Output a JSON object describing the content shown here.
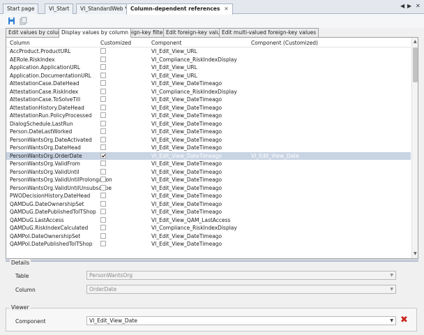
{
  "doc_tabs": [
    {
      "label": "Start page",
      "active": false
    },
    {
      "label": "VI_Start",
      "active": false
    },
    {
      "label": "VI_StandardWeb *",
      "active": false
    },
    {
      "label": "Column-dependent references",
      "active": true
    }
  ],
  "window_controls": {
    "prev": "◀",
    "next": "▶",
    "close": "✕"
  },
  "toolbar": [
    {
      "name": "save-icon",
      "color": "#2f7fd1"
    },
    {
      "name": "copy-icon",
      "color": "#9aa3ad"
    }
  ],
  "inner_tabs": [
    "Edit values by column",
    "Display values by column",
    "Foreign-key filters",
    "Edit foreign-key values",
    "Edit multi-valued foreign-key values"
  ],
  "grid": {
    "headers": [
      "Column",
      "Customized",
      "Component",
      "Component (Customized)"
    ],
    "rows": [
      {
        "column": "AccProduct.ProductURL",
        "checked": false,
        "component": "VI_Edit_View_URL",
        "customized_component": ""
      },
      {
        "column": "AERole.RiskIndex",
        "checked": false,
        "component": "VI_Compliance_RiskIndexDisplay",
        "customized_component": ""
      },
      {
        "column": "Application.ApplicationURL",
        "checked": false,
        "component": "VI_Edit_View_URL",
        "customized_component": ""
      },
      {
        "column": "Application.DocumentationURL",
        "checked": false,
        "component": "VI_Edit_View_URL",
        "customized_component": ""
      },
      {
        "column": "AttestationCase.DateHead",
        "checked": false,
        "component": "VI_Edit_View_DateTimeago",
        "customized_component": ""
      },
      {
        "column": "AttestationCase.RiskIndex",
        "checked": false,
        "component": "VI_Compliance_RiskIndexDisplay",
        "customized_component": ""
      },
      {
        "column": "AttestationCase.ToSolveTill",
        "checked": false,
        "component": "VI_Edit_View_DateTimeago",
        "customized_component": ""
      },
      {
        "column": "AttestationHistory.DateHead",
        "checked": false,
        "component": "VI_Edit_View_DateTimeago",
        "customized_component": ""
      },
      {
        "column": "AttestationRun.PolicyProcessed",
        "checked": false,
        "component": "VI_Edit_View_DateTimeago",
        "customized_component": ""
      },
      {
        "column": "DialogSchedule.LastRun",
        "checked": false,
        "component": "VI_Edit_View_DateTimeago",
        "customized_component": ""
      },
      {
        "column": "Person.DateLastWorked",
        "checked": false,
        "component": "VI_Edit_View_DateTimeago",
        "customized_component": ""
      },
      {
        "column": "PersonWantsOrg.DateActivated",
        "checked": false,
        "component": "VI_Edit_View_DateTimeago",
        "customized_component": ""
      },
      {
        "column": "PersonWantsOrg.DateHead",
        "checked": false,
        "component": "VI_Edit_View_DateTimeago",
        "customized_component": ""
      },
      {
        "column": "PersonWantsOrg.OrderDate",
        "checked": true,
        "component": "VI_Edit_View_DateTimeago",
        "customized_component": "VI_Edit_View_Date",
        "selected": true
      },
      {
        "column": "PersonWantsOrg.ValidFrom",
        "checked": false,
        "component": "VI_Edit_View_DateTimeago",
        "customized_component": ""
      },
      {
        "column": "PersonWantsOrg.ValidUntil",
        "checked": false,
        "component": "VI_Edit_View_DateTimeago",
        "customized_component": ""
      },
      {
        "column": "PersonWantsOrg.ValidUntilProlongation",
        "checked": false,
        "component": "VI_Edit_View_DateTimeago",
        "customized_component": ""
      },
      {
        "column": "PersonWantsOrg.ValidUntilUnsubscribe",
        "checked": false,
        "component": "VI_Edit_View_DateTimeago",
        "customized_component": ""
      },
      {
        "column": "PWODecisionHistory.DateHead",
        "checked": false,
        "component": "VI_Edit_View_DateTimeago",
        "customized_component": ""
      },
      {
        "column": "QAMDuG.DateOwnershipSet",
        "checked": false,
        "component": "VI_Edit_View_DateTimeago",
        "customized_component": ""
      },
      {
        "column": "QAMDuG.DatePublishedToITShop",
        "checked": false,
        "component": "VI_Edit_View_DateTimeago",
        "customized_component": ""
      },
      {
        "column": "QAMDuG.LastAccess",
        "checked": false,
        "component": "VI_Edit_View_QAM_LastAccess",
        "customized_component": ""
      },
      {
        "column": "QAMDuG.RiskIndexCalculated",
        "checked": false,
        "component": "VI_Compliance_RiskIndexDisplay",
        "customized_component": ""
      },
      {
        "column": "QAMPoI.DateOwnershipSet",
        "checked": false,
        "component": "VI_Edit_View_DateTimeago",
        "customized_component": ""
      },
      {
        "column": "QAMPoI.DatePublishedToITShop",
        "checked": false,
        "component": "VI_Edit_View_DateTimeago",
        "customized_component": ""
      }
    ]
  },
  "details": {
    "title": "Details",
    "table_label": "Table",
    "table_value": "PersonWantsOrg",
    "column_label": "Column",
    "column_value": "OrderDate"
  },
  "viewer": {
    "title": "Viewer",
    "component_label": "Component",
    "component_value": "VI_Edit_View_Date",
    "delete_glyph": "✖"
  },
  "dropdown_glyph": "▼",
  "scroll_up_glyph": "▲",
  "scroll_down_glyph": "▼"
}
